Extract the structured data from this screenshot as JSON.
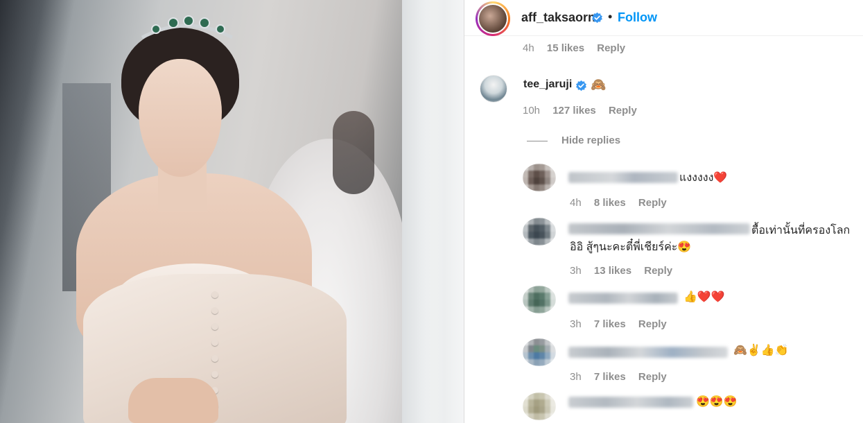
{
  "header": {
    "username": "aff_taksaorn",
    "dot": "•",
    "follow_label": "Follow"
  },
  "top_meta": {
    "time": "4h",
    "likes": "15 likes",
    "reply": "Reply"
  },
  "main_comment": {
    "username": "tee_jaruji",
    "emoji": "🙈",
    "time": "10h",
    "likes": "127 likes",
    "reply": "Reply"
  },
  "hide_replies_label": "Hide replies",
  "replies": [
    {
      "text": "แงงงงง",
      "emoji": "❤️",
      "time": "4h",
      "likes": "8 likes",
      "reply": "Reply"
    },
    {
      "text": "ตื้อเท่านั้นที่ครองโลก",
      "text2": "อิอิ สู้ๆนะคะตี๋พี่เชียร์ค่ะ",
      "emoji": "😍",
      "time": "3h",
      "likes": "13 likes",
      "reply": "Reply"
    },
    {
      "text": "",
      "emoji": "👍❤️❤️",
      "time": "3h",
      "likes": "7 likes",
      "reply": "Reply"
    },
    {
      "text": "",
      "emoji": "🙈✌️👍👏",
      "time": "3h",
      "likes": "7 likes",
      "reply": "Reply"
    },
    {
      "text": "",
      "emoji": "😍😍😍",
      "time": "",
      "likes": "",
      "reply": ""
    }
  ],
  "colors": {
    "follow": "#0095f6",
    "verified": "#3897f0",
    "secondary_text": "#8e8e8e",
    "primary_text": "#262626"
  }
}
